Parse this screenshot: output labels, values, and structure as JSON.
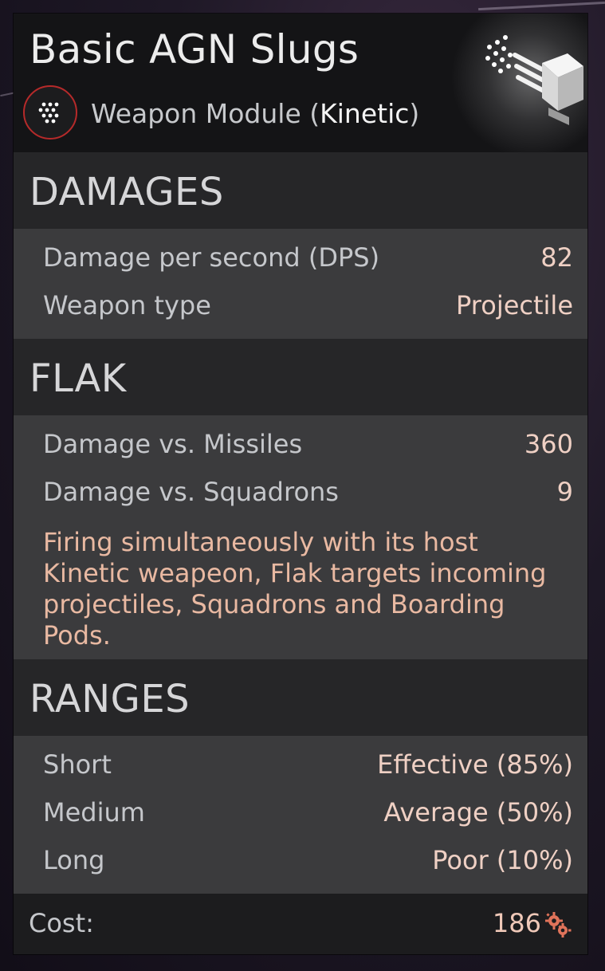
{
  "header": {
    "title": "Basic AGN Slugs",
    "subtitle_prefix": "Weapon Module (",
    "subtitle_highlight": "Kinetic",
    "subtitle_suffix": ")",
    "type_icon": "dot-grid-icon",
    "module_icon": "flak-module-icon"
  },
  "sections": {
    "damages": {
      "heading": "DAMAGES",
      "rows": [
        {
          "label": "Damage per second (DPS)",
          "value": "82"
        },
        {
          "label": "Weapon type",
          "value": "Projectile"
        }
      ]
    },
    "flak": {
      "heading": "FLAK",
      "rows": [
        {
          "label": "Damage vs. Missiles",
          "value": "360"
        },
        {
          "label": "Damage vs. Squadrons",
          "value": "9"
        }
      ],
      "description_lines": [
        "Firing simultaneously with its host",
        "Kinetic weapeon, Flak targets incoming",
        "projectiles, Squadrons and Boarding",
        "Pods."
      ]
    },
    "ranges": {
      "heading": "RANGES",
      "rows": [
        {
          "label": "Short",
          "value": "Effective (85%)"
        },
        {
          "label": "Medium",
          "value": "Average (50%)"
        },
        {
          "label": "Long",
          "value": "Poor (10%)"
        }
      ]
    }
  },
  "footer": {
    "cost_label": "Cost:",
    "cost_value": "186",
    "cost_icon": "gears-icon"
  },
  "colors": {
    "accent_ring": "#b62a2a",
    "value_text": "#efd0c4",
    "description_text": "#e9b9a2",
    "cost_icon": "#e0735a"
  }
}
